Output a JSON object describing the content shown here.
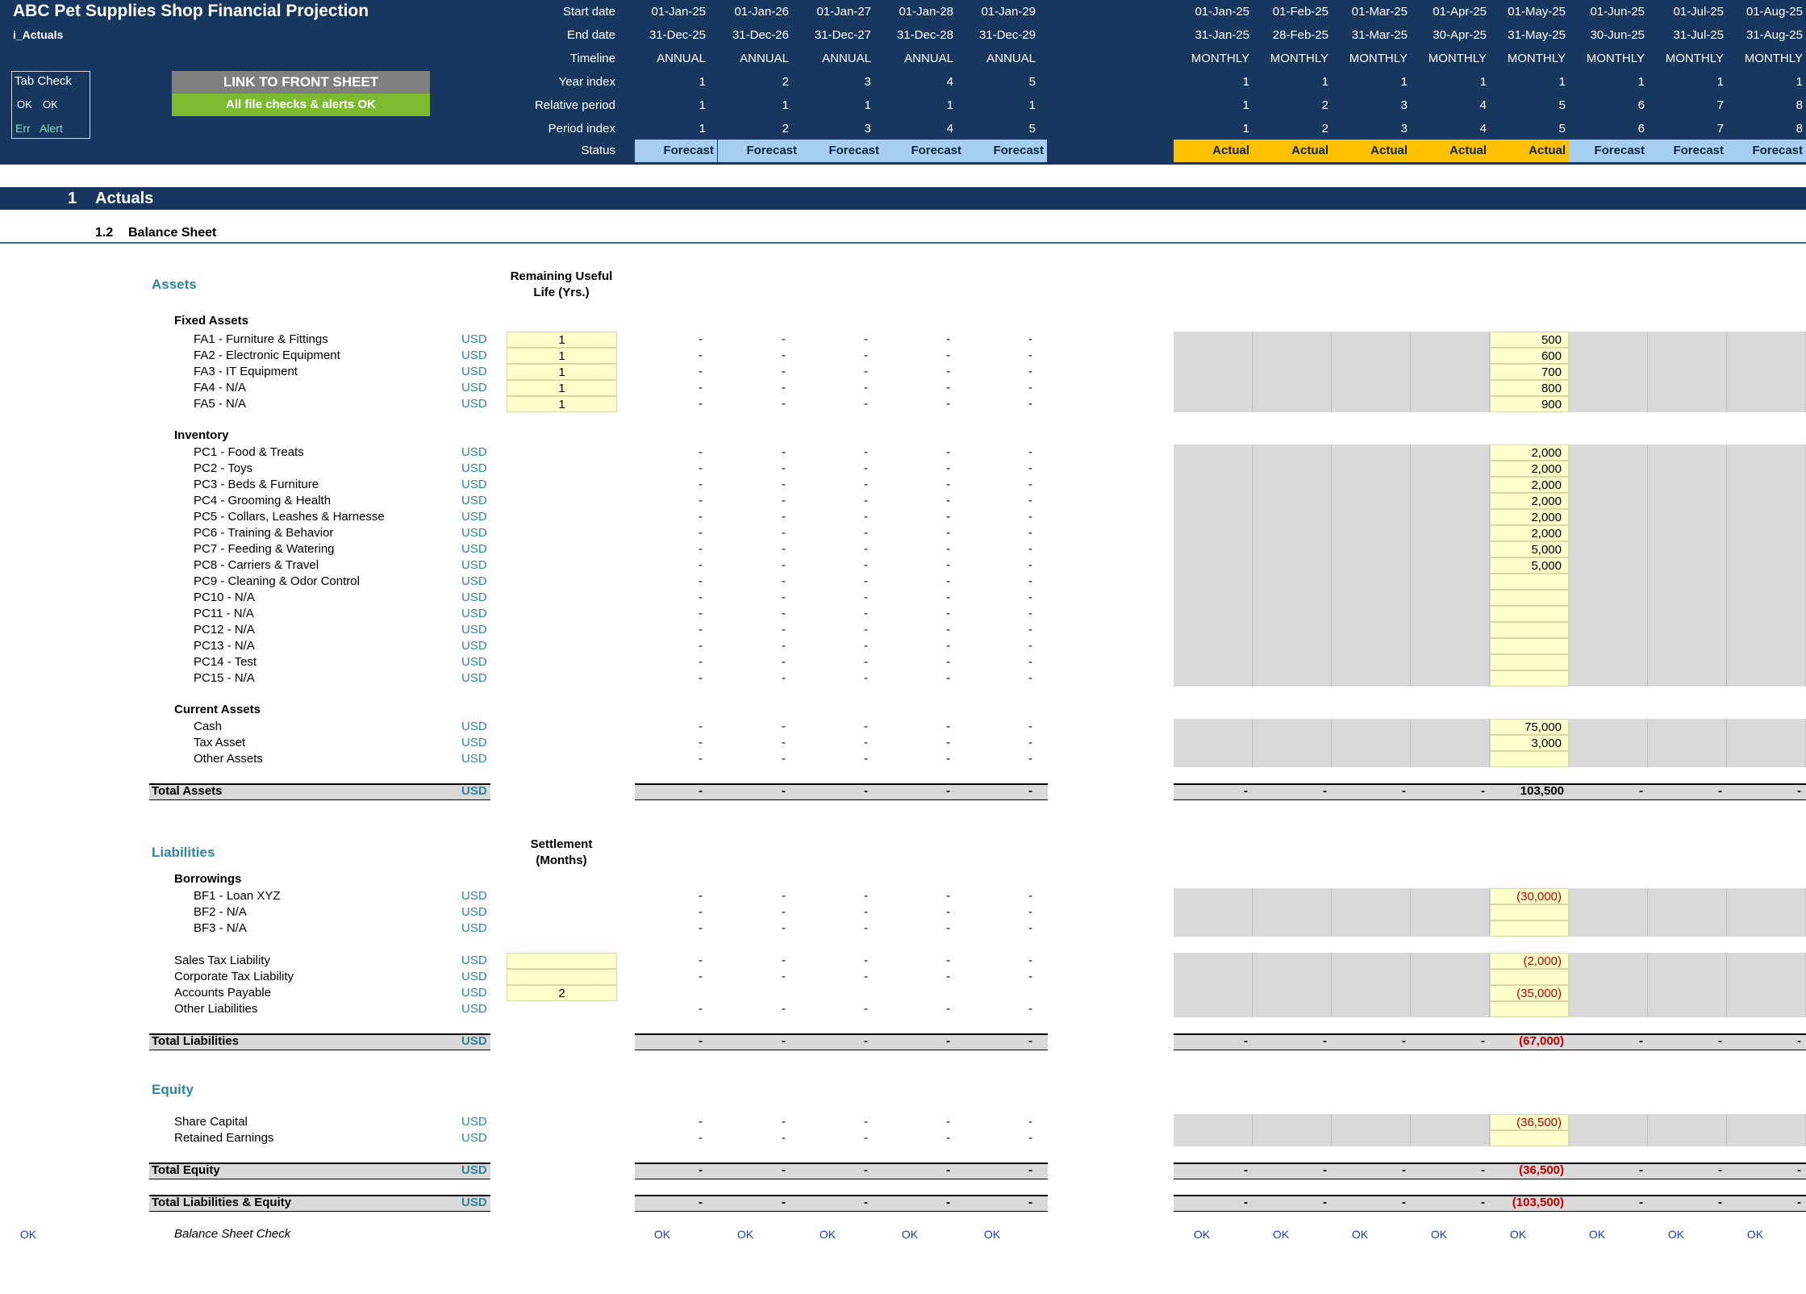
{
  "header": {
    "title": "ABC Pet Supplies Shop Financial Projection",
    "sheet": "i_Actuals",
    "tab_check": {
      "title": "Tab Check",
      "ok1": "OK",
      "ok2": "OK",
      "err": "Err",
      "alert": "Alert"
    },
    "link_button": "LINK TO FRONT SHEET",
    "checks_status": "All file checks & alerts OK",
    "row_labels": [
      "Start date",
      "End date",
      "Timeline",
      "Year index",
      "Relative period",
      "Period index",
      "Status"
    ],
    "annual": [
      {
        "start": "01-Jan-25",
        "end": "31-Dec-25",
        "timeline": "ANNUAL",
        "year": "1",
        "rel": "1",
        "pidx": "1",
        "status": "Forecast"
      },
      {
        "start": "01-Jan-26",
        "end": "31-Dec-26",
        "timeline": "ANNUAL",
        "year": "2",
        "rel": "1",
        "pidx": "2",
        "status": "Forecast"
      },
      {
        "start": "01-Jan-27",
        "end": "31-Dec-27",
        "timeline": "ANNUAL",
        "year": "3",
        "rel": "1",
        "pidx": "3",
        "status": "Forecast"
      },
      {
        "start": "01-Jan-28",
        "end": "31-Dec-28",
        "timeline": "ANNUAL",
        "year": "4",
        "rel": "1",
        "pidx": "4",
        "status": "Forecast"
      },
      {
        "start": "01-Jan-29",
        "end": "31-Dec-29",
        "timeline": "ANNUAL",
        "year": "5",
        "rel": "1",
        "pidx": "5",
        "status": "Forecast"
      }
    ],
    "monthly": [
      {
        "start": "01-Jan-25",
        "end": "31-Jan-25",
        "timeline": "MONTHLY",
        "year": "1",
        "rel": "1",
        "pidx": "1",
        "status": "Actual"
      },
      {
        "start": "01-Feb-25",
        "end": "28-Feb-25",
        "timeline": "MONTHLY",
        "year": "1",
        "rel": "2",
        "pidx": "2",
        "status": "Actual"
      },
      {
        "start": "01-Mar-25",
        "end": "31-Mar-25",
        "timeline": "MONTHLY",
        "year": "1",
        "rel": "3",
        "pidx": "3",
        "status": "Actual"
      },
      {
        "start": "01-Apr-25",
        "end": "30-Apr-25",
        "timeline": "MONTHLY",
        "year": "1",
        "rel": "4",
        "pidx": "4",
        "status": "Actual"
      },
      {
        "start": "01-May-25",
        "end": "31-May-25",
        "timeline": "MONTHLY",
        "year": "1",
        "rel": "5",
        "pidx": "5",
        "status": "Actual"
      },
      {
        "start": "01-Jun-25",
        "end": "30-Jun-25",
        "timeline": "MONTHLY",
        "year": "1",
        "rel": "6",
        "pidx": "6",
        "status": "Forecast"
      },
      {
        "start": "01-Jul-25",
        "end": "31-Jul-25",
        "timeline": "MONTHLY",
        "year": "1",
        "rel": "7",
        "pidx": "7",
        "status": "Forecast"
      },
      {
        "start": "01-Aug-25",
        "end": "31-Aug-25",
        "timeline": "MONTHLY",
        "year": "1",
        "rel": "8",
        "pidx": "8",
        "status": "Forecast"
      }
    ]
  },
  "section": {
    "number": "1",
    "title": "Actuals",
    "sub_number": "1.2",
    "sub_title": "Balance Sheet"
  },
  "assets": {
    "heading": "Assets",
    "life_header_1": "Remaining Useful",
    "life_header_2": "Life (Yrs.)",
    "fixed": {
      "title": "Fixed Assets",
      "rows": [
        {
          "label": "FA1 - Furniture & Fittings",
          "unit": "USD",
          "life": "1",
          "may": "500"
        },
        {
          "label": "FA2 - Electronic Equipment",
          "unit": "USD",
          "life": "1",
          "may": "600"
        },
        {
          "label": "FA3 - IT Equipment",
          "unit": "USD",
          "life": "1",
          "may": "700"
        },
        {
          "label": "FA4 - N/A",
          "unit": "USD",
          "life": "1",
          "may": "800"
        },
        {
          "label": "FA5 - N/A",
          "unit": "USD",
          "life": "1",
          "may": "900"
        }
      ]
    },
    "inventory": {
      "title": "Inventory",
      "rows": [
        {
          "label": "PC1 - Food & Treats",
          "unit": "USD",
          "may": "2,000"
        },
        {
          "label": "PC2 - Toys",
          "unit": "USD",
          "may": "2,000"
        },
        {
          "label": "PC3 - Beds & Furniture",
          "unit": "USD",
          "may": "2,000"
        },
        {
          "label": "PC4 - Grooming & Health",
          "unit": "USD",
          "may": "2,000"
        },
        {
          "label": "PC5 - Collars, Leashes & Harnesse",
          "unit": "USD",
          "may": "2,000"
        },
        {
          "label": "PC6 - Training & Behavior",
          "unit": "USD",
          "may": "2,000"
        },
        {
          "label": "PC7 - Feeding & Watering",
          "unit": "USD",
          "may": "5,000"
        },
        {
          "label": "PC8 - Carriers & Travel",
          "unit": "USD",
          "may": "5,000"
        },
        {
          "label": "PC9 - Cleaning & Odor Control",
          "unit": "USD",
          "may": ""
        },
        {
          "label": "PC10 - N/A",
          "unit": "USD",
          "may": ""
        },
        {
          "label": "PC11 - N/A",
          "unit": "USD",
          "may": ""
        },
        {
          "label": "PC12 - N/A",
          "unit": "USD",
          "may": ""
        },
        {
          "label": "PC13 - N/A",
          "unit": "USD",
          "may": ""
        },
        {
          "label": "PC14 - Test",
          "unit": "USD",
          "may": ""
        },
        {
          "label": "PC15 - N/A",
          "unit": "USD",
          "may": ""
        }
      ]
    },
    "current": {
      "title": "Current Assets",
      "rows": [
        {
          "label": "Cash",
          "unit": "USD",
          "may": "75,000"
        },
        {
          "label": "Tax Asset",
          "unit": "USD",
          "may": "3,000"
        },
        {
          "label": "Other Assets",
          "unit": "USD",
          "may": ""
        }
      ]
    },
    "total": {
      "label": "Total Assets",
      "unit": "USD",
      "may": "103,500"
    }
  },
  "liabilities": {
    "heading": "Liabilities",
    "settle_header_1": "Settlement",
    "settle_header_2": "(Months)",
    "borrowings": {
      "title": "Borrowings",
      "rows": [
        {
          "label": "BF1 - Loan XYZ",
          "unit": "USD",
          "may": "(30,000)"
        },
        {
          "label": "BF2 - N/A",
          "unit": "USD",
          "may": ""
        },
        {
          "label": "BF3 - N/A",
          "unit": "USD",
          "may": ""
        }
      ]
    },
    "other_rows": [
      {
        "label": "Sales Tax Liability",
        "unit": "USD",
        "settle": "",
        "may": "(2,000)"
      },
      {
        "label": "Corporate Tax Liability",
        "unit": "USD",
        "settle": "",
        "may": ""
      },
      {
        "label": "Accounts Payable",
        "unit": "USD",
        "settle": "2",
        "may": "(35,000)"
      },
      {
        "label": "Other Liabilities",
        "unit": "USD",
        "may": ""
      }
    ],
    "total": {
      "label": "Total Liabilities",
      "unit": "USD",
      "may": "(67,000)"
    }
  },
  "equity": {
    "heading": "Equity",
    "rows": [
      {
        "label": "Share Capital",
        "unit": "USD",
        "may": "(36,500)"
      },
      {
        "label": "Retained Earnings",
        "unit": "USD",
        "may": ""
      }
    ],
    "total": {
      "label": "Total Equity",
      "unit": "USD",
      "may": "(36,500)"
    }
  },
  "total_le": {
    "label": "Total Liabilities & Equity",
    "unit": "USD",
    "may": "(103,500)"
  },
  "dash": "-",
  "check": {
    "left": "OK",
    "label": "Balance Sheet Check",
    "value": "OK"
  },
  "colors": {
    "header_bg": "#17375e",
    "forecast": "#a6cef0",
    "actual": "#ffc000",
    "input": "#ffffcc",
    "teal": "#31859c",
    "negative": "#c00000",
    "ok_green": "#7cbb2f"
  }
}
